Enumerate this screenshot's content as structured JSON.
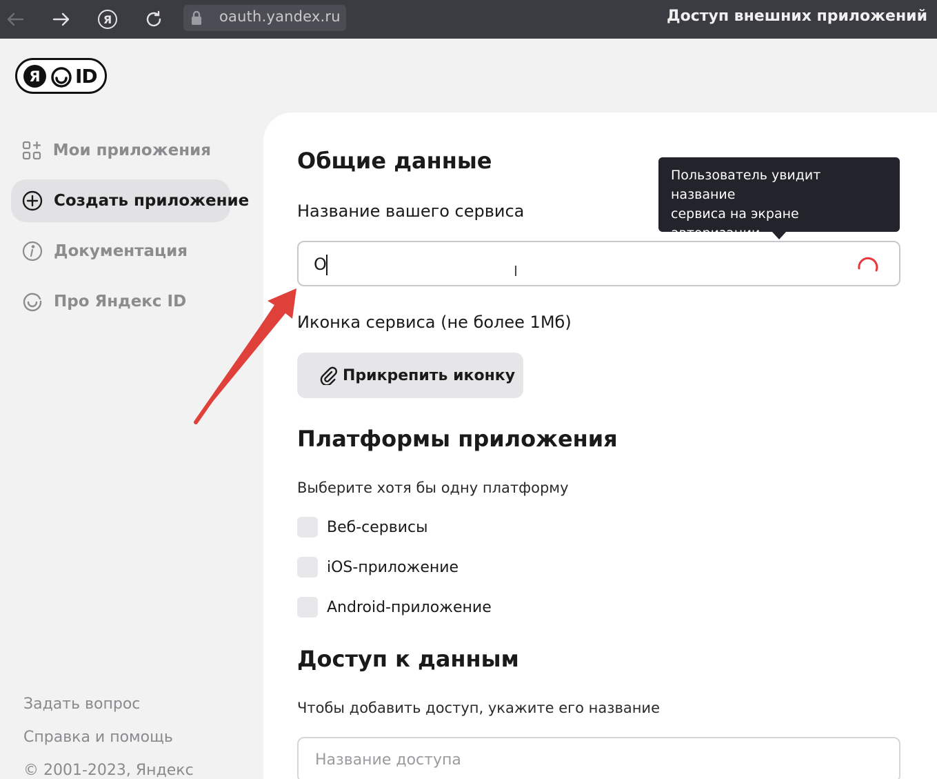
{
  "browser": {
    "url": "oauth.yandex.ru",
    "window_title": "Доступ внешних приложений"
  },
  "logo": {
    "ya": "Я",
    "id": "ID"
  },
  "sidebar": {
    "items": [
      {
        "label": "Мои приложения",
        "icon": "apps-grid-icon"
      },
      {
        "label": "Создать приложение",
        "icon": "plus-circle-icon"
      },
      {
        "label": "Документация",
        "icon": "info-circle-icon"
      },
      {
        "label": "Про Яндекс ID",
        "icon": "yandex-id-smile-icon"
      }
    ],
    "footer": {
      "ask": "Задать вопрос",
      "help": "Справка и помощь",
      "copyright": "© 2001-2023, Яндекс"
    }
  },
  "form": {
    "general_title": "Общие данные",
    "name_label": "Название вашего сервиса",
    "name_value": "О",
    "tooltip": [
      "Пользователь увидит название",
      "сервиса на экране",
      "авторизации"
    ],
    "icon_label": "Иконка сервиса (не более 1Мб)",
    "attach_label": "Прикрепить иконку",
    "platforms_title": "Платформы приложения",
    "platforms_hint": "Выберите хотя бы одну платформу",
    "platforms": [
      {
        "label": "Веб-сервисы",
        "checked": false
      },
      {
        "label": "iOS-приложение",
        "checked": false
      },
      {
        "label": "Android-приложение",
        "checked": false
      }
    ],
    "access_title": "Доступ к данным",
    "access_hint": "Чтобы добавить доступ, укажите его название",
    "access_placeholder": "Название доступа"
  },
  "colors": {
    "accent_red": "#e0403a",
    "spinner_red": "#e8383d",
    "tooltip_bg": "#22232b"
  }
}
